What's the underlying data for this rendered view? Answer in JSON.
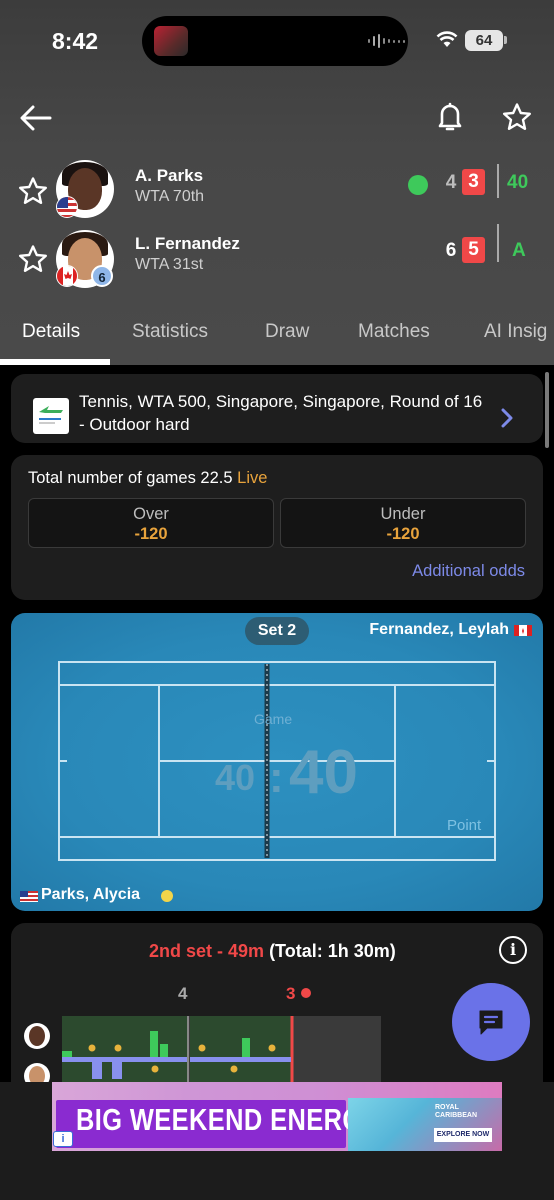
{
  "status_bar": {
    "time": "8:42",
    "battery": "64"
  },
  "nav": {
    "back_icon": "arrow-left-icon",
    "bell_icon": "bell-icon",
    "star_icon": "star-outline-icon"
  },
  "players": [
    {
      "name": "A. Parks",
      "rank": "WTA 70th",
      "country": "USA",
      "serving": true,
      "set1": "4",
      "set2": "3",
      "points": "40"
    },
    {
      "name": "L. Fernandez",
      "rank": "WTA 31st",
      "country": "Canada",
      "seed": "6",
      "serving": false,
      "set1": "6",
      "set2": "5",
      "points": "A"
    }
  ],
  "tabs": [
    "Details",
    "Statistics",
    "Draw",
    "Matches",
    "AI Insig"
  ],
  "tournament": {
    "text": "Tennis, WTA 500, Singapore, Singapore, Round of 16 - Outdoor hard"
  },
  "odds": {
    "title": "Total number of games 22.5",
    "live": "Live",
    "over_label": "Over",
    "over_value": "-120",
    "under_label": "Under",
    "under_value": "-120",
    "more": "Additional odds"
  },
  "court": {
    "set_label": "Set 2",
    "top_player": "Fernandez, Leylah",
    "bottom_player": "Parks, Alycia",
    "game_label": "Game",
    "point_label": "Point",
    "score_left": "40",
    "score_sep": ":",
    "score_right": "40"
  },
  "timeline": {
    "set_label": "2nd set - 49m",
    "total_label": "(Total: 1h 30m)",
    "marker_a": "4",
    "marker_b": "3"
  },
  "ad": {
    "headline": "BIG WEEKEND ENERGY",
    "brand": "ROYAL CARIBBEAN",
    "cta": "EXPLORE NOW"
  },
  "colors": {
    "accent_green": "#3ec95b",
    "accent_red": "#f04848",
    "odds_orange": "#e8a33c",
    "link_purple": "#7d8ae8",
    "court_blue": "#2988b8"
  }
}
